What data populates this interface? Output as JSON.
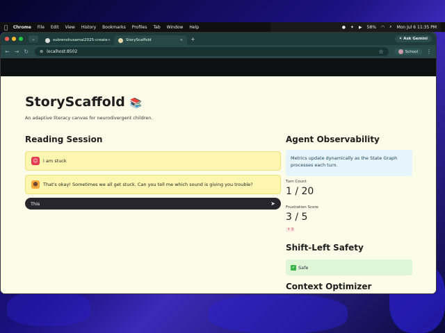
{
  "menubar": {
    "apple": "",
    "items": [
      "Chrome",
      "File",
      "Edit",
      "View",
      "History",
      "Bookmarks",
      "Profiles",
      "Tab",
      "Window",
      "Help"
    ],
    "battery": "58%",
    "clock": "Mon Jul 6  11:35 PM"
  },
  "browser": {
    "tabs": [
      {
        "label": "subrenshusamal2025-create",
        "active": false
      },
      {
        "label": "StoryScaffold",
        "active": true
      }
    ],
    "new_tab": "+",
    "ask_gemini": "Ask Gemini",
    "url": "localhost:8502",
    "profile": "School"
  },
  "app": {
    "title": "StoryScaffold",
    "title_emoji": "📚",
    "subtitle": "An adaptive literacy canvas for neurodivergent children."
  },
  "reading": {
    "heading": "Reading Session",
    "messages": [
      {
        "role": "user",
        "text": "i am stuck"
      },
      {
        "role": "assistant",
        "text": "That's okay! Sometimes we all get stuck. Can you tell me which sound is giving you trouble?"
      }
    ],
    "input_value": "This"
  },
  "observability": {
    "heading": "Agent Observability",
    "info": "Metrics update dynamically as the State Graph processes each turn.",
    "turn_label": "Turn Count",
    "turn_value": "1 / 20",
    "frustration_label": "Frustration Score",
    "frustration_value": "3 / 5",
    "frustration_delta": "↑ 3"
  },
  "safety": {
    "heading": "Shift-Left Safety",
    "status": "Safe"
  },
  "context": {
    "heading": "Context Optimizer"
  },
  "colors": {
    "page_bg": "#fbfde9",
    "message_bg": "#fdf6b0",
    "info_bg": "#e6f4fb",
    "safe_bg": "#dff7d6"
  }
}
